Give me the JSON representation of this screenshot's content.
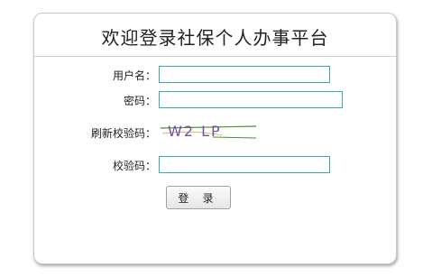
{
  "page": {
    "title": "欢迎登录社保个人办事平台"
  },
  "form": {
    "username_label": "用户名：",
    "username_value": "",
    "password_label": "密码：",
    "password_value": "",
    "refresh_captcha_label": "刷新校验码：",
    "captcha_image_text": "W2 LP",
    "captcha_label": "校验码：",
    "captcha_value": "",
    "login_button": "登 录"
  },
  "colors": {
    "input_border": "#3aa6b9",
    "captcha_text": "#7b4fa8",
    "captcha_line": "#4e8f2e"
  }
}
